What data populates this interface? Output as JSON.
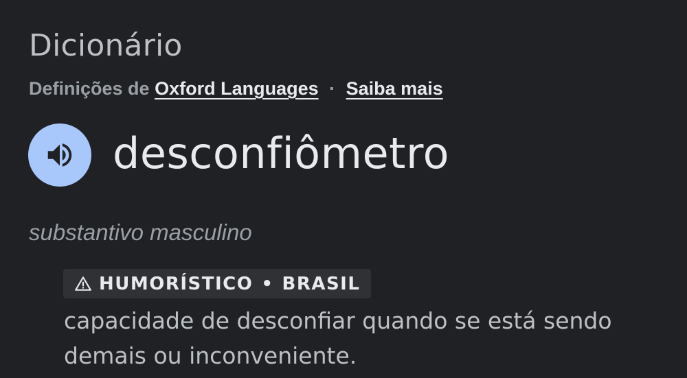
{
  "dictionary": {
    "title": "Dicionário",
    "source_prefix": "Definições de",
    "source_link": "Oxford Languages",
    "separator": "·",
    "learn_more": "Saiba mais",
    "speaker_icon": "speaker-icon",
    "headword": "desconfiômetro",
    "part_of_speech": "substantivo masculino",
    "tag": {
      "icon": "warning-icon",
      "register": "HUMORÍSTICO",
      "separator": "•",
      "region": "BRASIL"
    },
    "definition": "capacidade de desconfiar quando se está sendo demais ou inconveniente.",
    "colors": {
      "background": "#202124",
      "speaker_button": "#a8c7fa",
      "tag_background": "#303134",
      "muted_text": "#9aa0a6",
      "primary_text": "#e8eaed"
    }
  }
}
